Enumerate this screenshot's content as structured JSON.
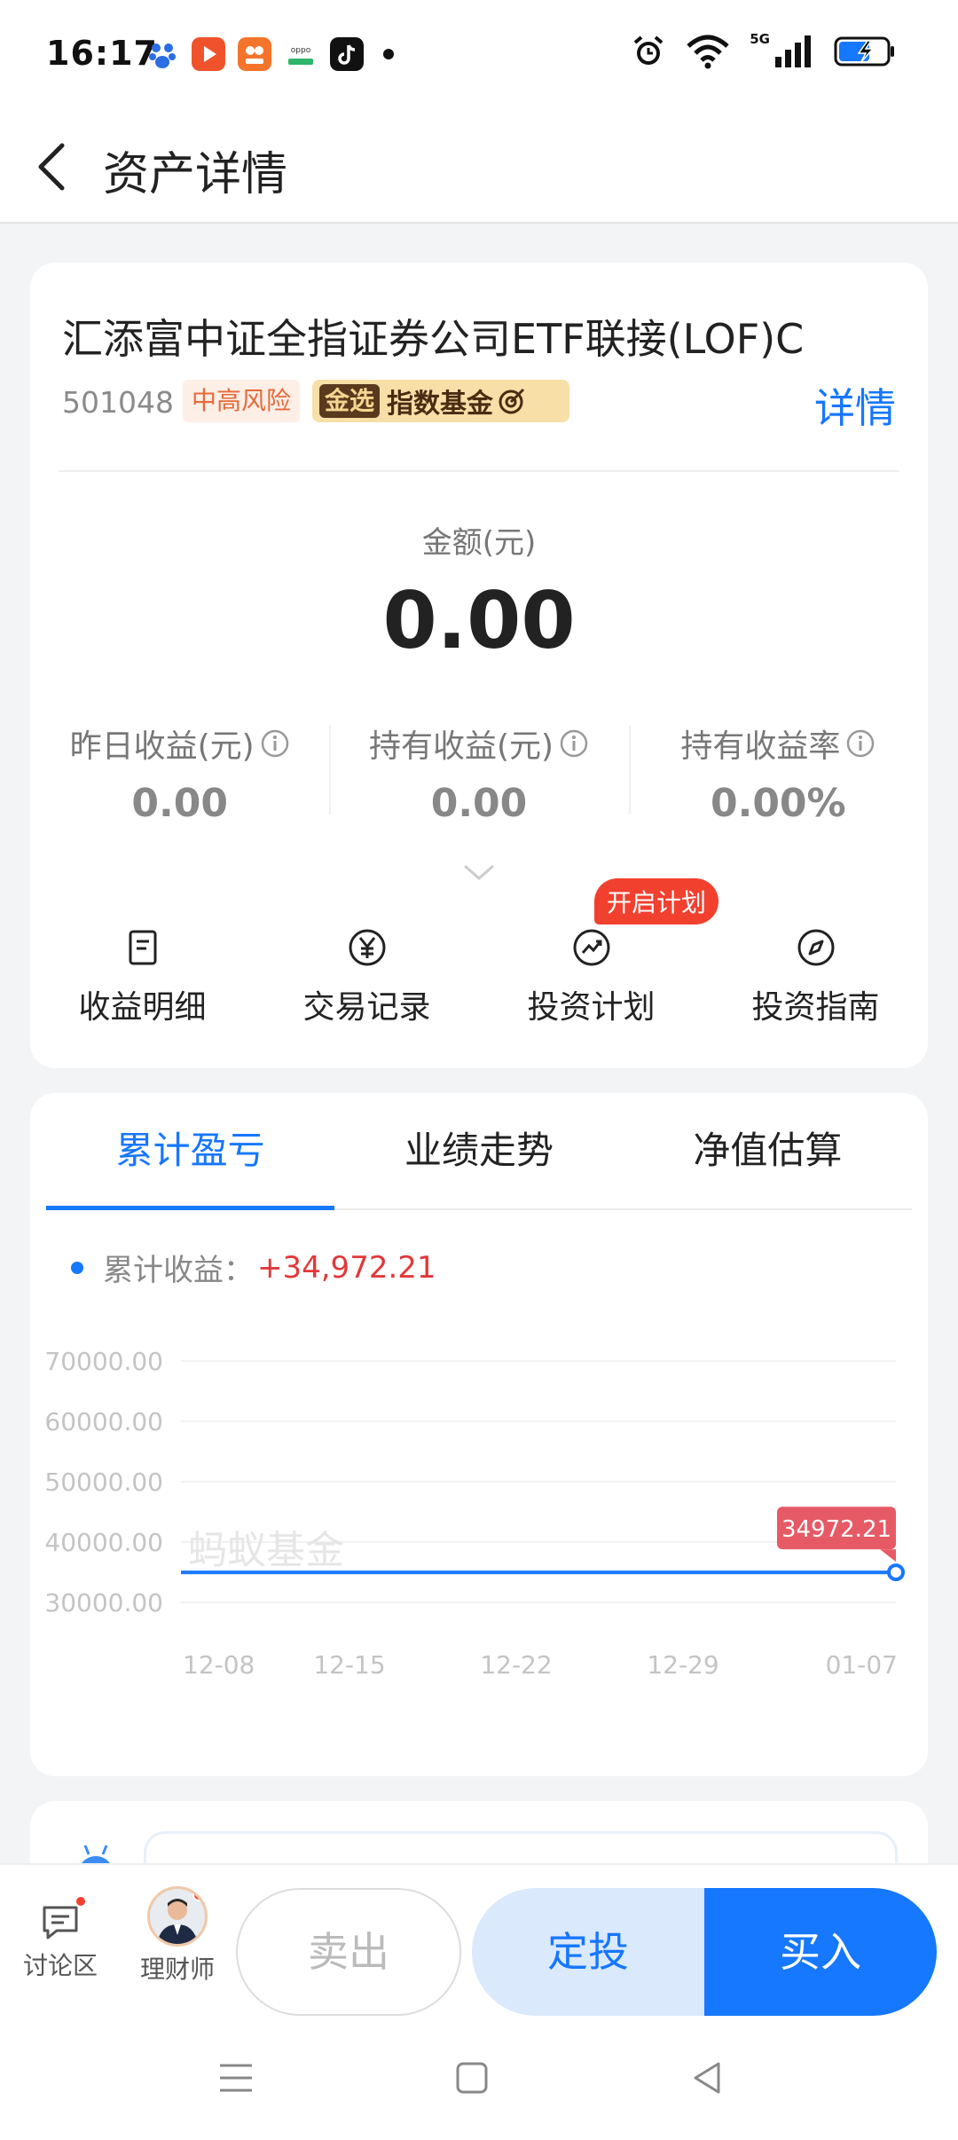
{
  "status_bar": {
    "time": "16:17",
    "network": "5G",
    "icons": [
      "baidu-icon",
      "video-icon",
      "market-icon",
      "oppo-icon",
      "tiktok-icon",
      "alarm-icon",
      "wifi-icon",
      "signal-icon",
      "battery-charging-icon"
    ]
  },
  "header": {
    "title": "资产详情",
    "back_icon": "back-chevron-icon"
  },
  "fund": {
    "name": "汇添富中证全指证券公司ETF联接(LOF)C",
    "code": "501048",
    "risk_tag": "中高风险",
    "gold_mark": "金选",
    "gold_label": "指数基金",
    "detail_link": "详情"
  },
  "holding": {
    "amount_label": "金额(元)",
    "amount_value": "0.00",
    "stats": [
      {
        "label": "昨日收益(元)",
        "value": "0.00"
      },
      {
        "label": "持有收益(元)",
        "value": "0.00"
      },
      {
        "label": "持有收益率",
        "value": "0.00%"
      }
    ]
  },
  "actions": [
    {
      "label": "收益明细",
      "icon": "document-icon"
    },
    {
      "label": "交易记录",
      "icon": "yen-circle-icon"
    },
    {
      "label": "投资计划",
      "icon": "trend-circle-icon",
      "badge": "开启计划"
    },
    {
      "label": "投资指南",
      "icon": "compass-icon"
    }
  ],
  "tabs": [
    "累计盈亏",
    "业绩走势",
    "净值估算"
  ],
  "active_tab": 0,
  "legend": {
    "label": "累计收益：",
    "value": "+34,972.21"
  },
  "watermark": "蚂蚁基金",
  "colors": {
    "accent": "#1677ff",
    "profit_red": "#e2383a",
    "badge_red": "#f2402f",
    "tooltip_red": "#e65a66"
  },
  "chart_data": {
    "type": "line",
    "title": "",
    "xlabel": "",
    "ylabel": "",
    "x": [
      "12-08",
      "12-15",
      "12-22",
      "12-29",
      "01-07"
    ],
    "series": [
      {
        "name": "累计收益",
        "values": [
          34972.21,
          34972.21,
          34972.21,
          34972.21,
          34972.21
        ]
      }
    ],
    "yticks": [
      "70000.00",
      "60000.00",
      "50000.00",
      "40000.00",
      "30000.00"
    ],
    "ylim": [
      30000,
      70000
    ],
    "last_point_label": "34972.21",
    "grid": true
  },
  "bottom_bar": {
    "discuss_label": "讨论区",
    "advisor_label": "理财师",
    "sell_label": "卖出",
    "sip_label": "定投",
    "buy_label": "买入"
  }
}
